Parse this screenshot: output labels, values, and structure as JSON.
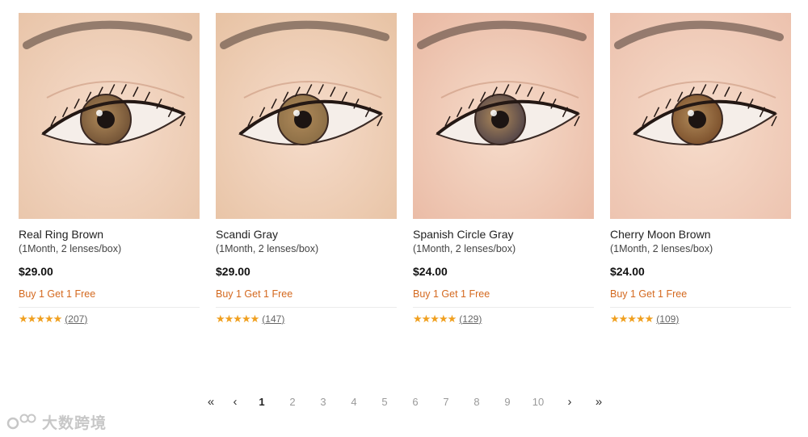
{
  "products": [
    {
      "name": "Real Ring Brown",
      "pack": "(1Month, 2 lenses/box)",
      "price": "$29.00",
      "promo": "Buy 1 Get 1 Free",
      "stars": "★★★★★",
      "reviews": "207",
      "iris": "#6f5034",
      "skin": "#e8c4a8"
    },
    {
      "name": "Scandi Gray",
      "pack": "(1Month, 2 lenses/box)",
      "price": "$29.00",
      "promo": "Buy 1 Get 1 Free",
      "stars": "★★★★★",
      "reviews": "147",
      "iris": "#8a6d45",
      "skin": "#e7c2a3"
    },
    {
      "name": "Spanish Circle Gray",
      "pack": "(1Month, 2 lenses/box)",
      "price": "$24.00",
      "promo": "Buy 1 Get 1 Free",
      "stars": "★★★★★",
      "reviews": "129",
      "iris": "#4f4248",
      "skin": "#e9b8a2"
    },
    {
      "name": "Cherry Moon Brown",
      "pack": "(1Month, 2 lenses/box)",
      "price": "$24.00",
      "promo": "Buy 1 Get 1 Free",
      "stars": "★★★★★",
      "reviews": "109",
      "iris": "#7a4e2a",
      "skin": "#ecc1ad"
    }
  ],
  "pagination": {
    "first": "«",
    "prev": "‹",
    "pages": [
      "1",
      "2",
      "3",
      "4",
      "5",
      "6",
      "7",
      "8",
      "9",
      "10"
    ],
    "current": "1",
    "next": "›",
    "last": "»"
  },
  "watermark": {
    "text": "大数跨境"
  },
  "colors": {
    "promo": "#d4691f",
    "star": "#f0a020"
  }
}
